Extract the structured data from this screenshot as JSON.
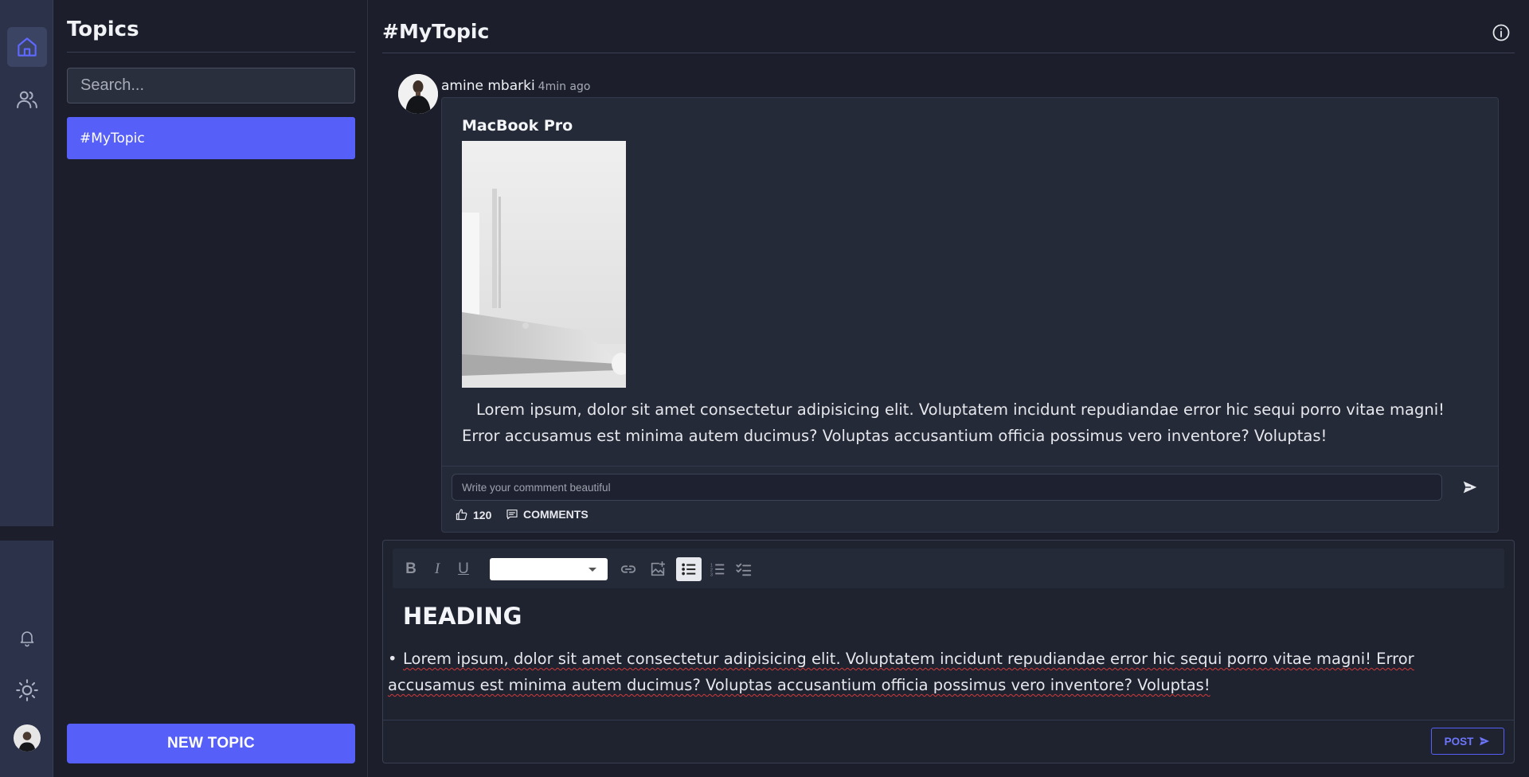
{
  "sidebar": {
    "active": "home",
    "icons": [
      "home-icon",
      "users-icon",
      "bell-icon",
      "sun-icon",
      "user-avatar"
    ]
  },
  "topics": {
    "title": "Topics",
    "search_placeholder": "Search...",
    "items": [
      {
        "label": "#MyTopic",
        "selected": true
      }
    ],
    "new_topic_label": "NEW TOPIC"
  },
  "main": {
    "title": "#MyTopic",
    "post": {
      "author": "amine mbarki",
      "time": "4min ago",
      "title": "MacBook Pro",
      "body": "Lorem ipsum, dolor sit amet consectetur adipisicing elit. Voluptatem incidunt repudiandae error hic sequi porro vitae magni! Error accusamus est minima autem ducimus? Voluptas accusantium officia possimus vero inventore? Voluptas!",
      "comment_placeholder": "Write your commment beautiful",
      "likes": "120",
      "comments_label": "COMMENTS"
    }
  },
  "editor": {
    "heading": "HEADING",
    "bullet": "Lorem ipsum, dolor sit amet consectetur adipisicing elit. Voluptatem incidunt repudiandae error hic sequi porro vitae magni! Error accusamus est minima autem ducimus? Voluptas accusantium officia possimus vero inventore? Voluptas!",
    "post_label": "POST",
    "toolbar": [
      "bold",
      "italic",
      "underline",
      "font-size-select",
      "link",
      "image",
      "bullet-list",
      "numbered-list",
      "checklist"
    ]
  },
  "colors": {
    "accent": "#5660f8",
    "background": "#1c1f2b",
    "rail": "#2b3249",
    "card": "#252a38"
  }
}
